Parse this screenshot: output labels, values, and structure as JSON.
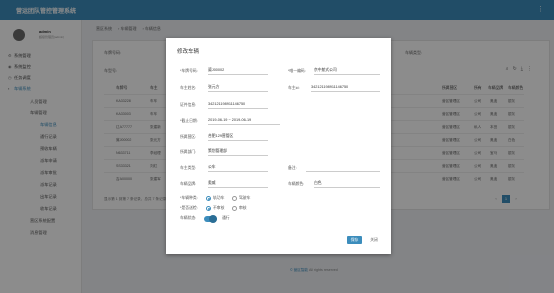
{
  "header": {
    "title": "营运团队管控管理系统",
    "menu_icon": "more-vertical-icon"
  },
  "user": {
    "name": "admin",
    "role": "超级管理员(admin)"
  },
  "sidebar": {
    "items": [
      {
        "label": "系统管理",
        "icon": "gear-icon"
      },
      {
        "label": "系统监控",
        "icon": "monitor-icon"
      },
      {
        "label": "任务调度",
        "icon": "clock-icon"
      },
      {
        "label": "车辆系统",
        "icon": "car-icon"
      }
    ],
    "sub": [
      {
        "label": "人员管理"
      },
      {
        "label": "车辆管理"
      },
      {
        "label": "车辆信息"
      },
      {
        "label": "通行记录"
      },
      {
        "label": "预收车辆"
      },
      {
        "label": "派车申请"
      },
      {
        "label": "派车审批"
      },
      {
        "label": "派车记录"
      },
      {
        "label": "出车记录"
      },
      {
        "label": "收车记录"
      },
      {
        "label": "营区系统配置"
      },
      {
        "label": "消息管理"
      }
    ]
  },
  "breadcrumb": [
    "营区系统",
    "车辆管理",
    "车辆信息"
  ],
  "filters": {
    "plate_label": "车牌号码:",
    "type_label": "车辆类型:",
    "dept_label": "车型号:"
  },
  "table": {
    "headers": [
      "车牌号",
      "车主",
      "所属营区",
      "所有",
      "车辆品牌",
      "车辆颜色"
    ],
    "rows": [
      {
        "plate": "KA33228",
        "owner": "车车",
        "camp": "营区管理区",
        "own": "公司",
        "brand": "奥迪",
        "color": "银灰"
      },
      {
        "plate": "KA33003",
        "owner": "车车",
        "camp": "营区管理区",
        "own": "公司",
        "brand": "奥迪",
        "color": "银灰"
      },
      {
        "plate": "辽A77777",
        "owner": "张建新",
        "camp": "营区管理区",
        "own": "私人",
        "brand": "本田",
        "color": "银灰"
      },
      {
        "plate": "冀J00002",
        "owner": "张元方",
        "camp": "营区管理区",
        "own": "公司",
        "brand": "奥迪",
        "color": "白色"
      },
      {
        "plate": "N633711",
        "owner": "李经理",
        "camp": "营区管理区",
        "own": "公司",
        "brand": "宝马",
        "color": "银灰"
      },
      {
        "plate": "SS33321",
        "owner": "刘红",
        "camp": "营区管理区",
        "own": "公司",
        "brand": "奥迪",
        "color": "银灰"
      },
      {
        "plate": "吉A00000",
        "owner": "张建军",
        "camp": "营区管理区",
        "own": "公司",
        "brand": "奥迪",
        "color": "银灰"
      }
    ]
  },
  "pagination": {
    "summary": "显示第 1 到第 7 条记录，总共 7 条记录",
    "prev": "‹",
    "current": "1",
    "next": "›"
  },
  "footer": {
    "brand": "© 营区智能",
    "rights": "All rights reserved"
  },
  "modal": {
    "title": "修改车辆",
    "fields": {
      "plate_label": "*车牌号码:",
      "plate_value": "冀J00002",
      "plate2_label": "*唯一编码:",
      "plate2_value": "京中航式公司",
      "owner_label": "车主姓名:",
      "owner_value": "张元方",
      "phone_label": "车主id:",
      "phone_value": "342121198911146750",
      "idcard_label": "证件信息:",
      "idcard_value": "342121198911146750",
      "date_label": "*截止日期:",
      "date_value": "2019-06-19 ~ 2019-06-19",
      "camp_label": "所属营区:",
      "camp_value": "合肥129营管区",
      "dept_label": "所属部门:",
      "dept_value": "策划管理部",
      "type_label": "车主类型:",
      "type_value": "公车",
      "remark_label": "备注:",
      "remark_value": "",
      "brand_label": "车辆品牌:",
      "brand_value": "奥威",
      "color_label": "车辆颜色:",
      "color_value": "白色",
      "nature_label": "*车辆种类:",
      "nature_opt1": "轨功车",
      "nature_opt2": "驾驶车",
      "check_label": "*是否送检:",
      "check_opt1": "不审核",
      "check_opt2": "审核",
      "status_label": "车辆状态:",
      "status_value": "通行"
    },
    "save": "保存",
    "close": "关闭"
  }
}
